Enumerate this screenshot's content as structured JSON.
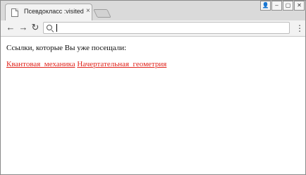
{
  "tab": {
    "title": "Псевдокласс :visited",
    "close_glyph": "×",
    "icon": "page-icon"
  },
  "window_controls": {
    "user": "👤",
    "minimize": "–",
    "maximize": "▢",
    "close": "✕"
  },
  "toolbar": {
    "back_glyph": "←",
    "forward_glyph": "→",
    "reload_glyph": "↻",
    "menu_glyph": "⋮",
    "address_value": ""
  },
  "content": {
    "lead_text": "Ссылки, которые Вы уже посещали:",
    "links": [
      {
        "label": "Квантовая_механика"
      },
      {
        "label": "Начертательная_геометрия"
      }
    ]
  },
  "colors": {
    "visited_link": "#e0251d"
  }
}
